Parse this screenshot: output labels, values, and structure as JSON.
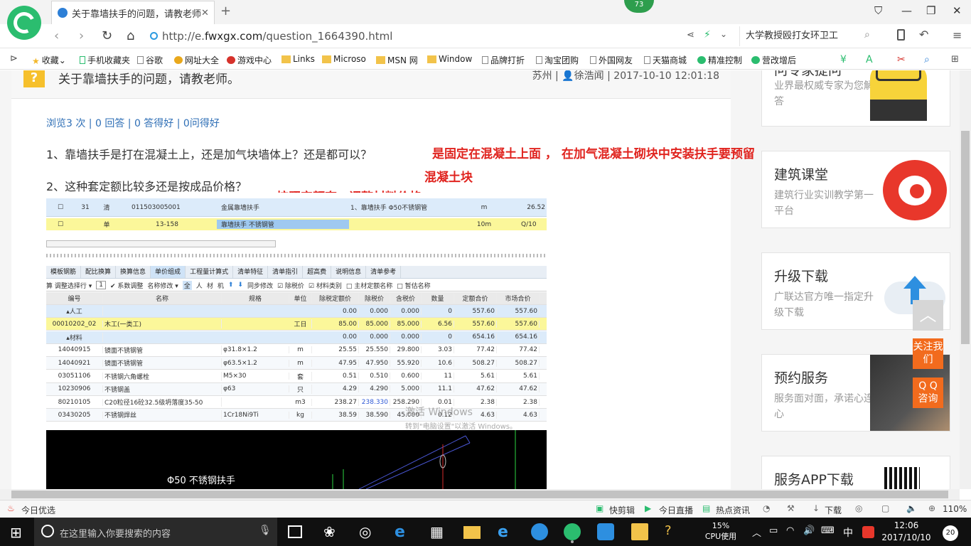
{
  "browser": {
    "tab_title": "关于靠墙扶手的问题，请教老师。",
    "tab_close": "✕",
    "new_tab": "+",
    "badge_count": "73",
    "url_prefix": "http://e.",
    "url_domain": "fwxgx.com",
    "url_path": "/question_1664390.html",
    "search_text": "大学教授殴打女环卫工",
    "bookmarks": [
      "收藏",
      "手机收藏夹",
      "谷歌",
      "网址大全",
      "游戏中心",
      "Links",
      "Microso",
      "MSN 网",
      "Window",
      "品牌打折",
      "淘宝团购",
      "外国网友",
      "天猫商城",
      "精准控制",
      "营改增后"
    ]
  },
  "question": {
    "icon": "?",
    "title": "关于靠墙扶手的问题，请教老师。",
    "city": "苏州",
    "user": "徐浩闻",
    "datetime": "2017-10-10 12:01:18",
    "stats": "浏览3 次 | 0 回答 | 0 答得好 | 0问得好",
    "line1": "1、靠墙扶手是打在混凝土上，还是加气块墙体上？还是都可以？",
    "line2": "2、这种套定额比较多还是按成品价格？",
    "note1": "是固定在混凝土上面 ， 在加气混凝土砌块中安装扶手要预留",
    "note2": "混凝土块",
    "note3": "按照定额套，调整材料价格"
  },
  "screenshot": {
    "top_row": {
      "num": "31",
      "type": "清",
      "code": "011503005001",
      "name": "金属靠墙扶手",
      "desc": "1、靠墙扶手 Φ50不锈钢管",
      "unit": "m",
      "qty": "26.52"
    },
    "sel_row": {
      "type": "单",
      "code": "13-158",
      "name": "靠墙扶手 不锈钢管",
      "unit": "10m",
      "qty": "Q/10"
    },
    "tabs": [
      "模板钢筋",
      "配比换算",
      "换算信息",
      "单价组成",
      "工程量计算式",
      "清单特征",
      "清单指引",
      "超高费",
      "说明信息",
      "清单参考"
    ],
    "toolbar": [
      "算 调整选择行 ▾",
      "1",
      "✔ 系数调整",
      "名称修改 ▾",
      "全",
      "人",
      "材",
      "机",
      "同步修改",
      "☑ 除税价",
      "☑ 材料类别",
      "□ 主材定额名称",
      "□ 暂估名称"
    ],
    "headers": [
      "编号",
      "名称",
      "规格",
      "单位",
      "除税定额价",
      "除税价",
      "含税价",
      "数量",
      "定额合价",
      "市场合价"
    ],
    "rows": [
      [
        "▴人工",
        "",
        "",
        "",
        "0.00",
        "0.000",
        "0.000",
        "0",
        "557.60",
        "557.60"
      ],
      [
        "00010202_02",
        "木工(一类工)",
        "",
        "工日",
        "85.00",
        "85.000",
        "85.000",
        "6.56",
        "557.60",
        "557.60"
      ],
      [
        "▴材料",
        "",
        "",
        "",
        "0.00",
        "0.000",
        "0.000",
        "0",
        "654.16",
        "654.16"
      ],
      [
        "14040915",
        "镜面不锈钢管",
        "φ31.8×1.2",
        "m",
        "25.55",
        "25.550",
        "29.800",
        "3.03",
        "77.42",
        "77.42"
      ],
      [
        "14040921",
        "镜面不锈钢管",
        "φ63.5×1.2",
        "m",
        "47.95",
        "47.950",
        "55.920",
        "10.6",
        "508.27",
        "508.27"
      ],
      [
        "03051106",
        "不锈钢六角螺栓",
        "M5×30",
        "套",
        "0.51",
        "0.510",
        "0.600",
        "11",
        "5.61",
        "5.61"
      ],
      [
        "10230906",
        "不锈钢盖",
        "φ63",
        "只",
        "4.29",
        "4.290",
        "5.000",
        "11.1",
        "47.62",
        "47.62"
      ],
      [
        "80210105",
        "C20粒径16砼32.5级坍落度35-50",
        "",
        "m3",
        "238.27",
        "238.330",
        "258.290",
        "0.01",
        "2.38",
        "2.38"
      ],
      [
        "03430205",
        "不锈钢焊丝",
        "1Cr18Ni9Ti",
        "kg",
        "38.59",
        "38.590",
        "45.000",
        "0.12",
        "4.63",
        "4.63"
      ]
    ],
    "watermark1": "激活 Windows",
    "watermark2": "转到\"电脑设置\"以激活 Windows。",
    "cad_label": "Φ50 不锈钢扶手"
  },
  "sidebar": {
    "cards": [
      {
        "title": "问专家提问",
        "sub": "业界最权威专家为您解答"
      },
      {
        "title": "建筑课堂",
        "sub": "建筑行业实训教学第一平台"
      },
      {
        "title": "升级下载",
        "sub": "广联达官方唯一指定升级下载"
      },
      {
        "title": "预约服务",
        "sub": "服务面对面，承诺心连心"
      },
      {
        "title": "服务APP下载",
        "sub": ""
      }
    ],
    "follow": "关注我们",
    "qq": "Q Q 咨询",
    "top_btn": "︿"
  },
  "statusbar": {
    "left": "今日优选",
    "items": [
      "快剪辑",
      "今日直播",
      "热点资讯",
      "下载"
    ],
    "zoom": "110%"
  },
  "taskbar": {
    "search_placeholder": "在这里输入你要搜索的内容",
    "cpu_pct": "15%",
    "cpu_label": "CPU使用",
    "ime": "中",
    "time": "12:06",
    "date": "2017/10/10",
    "notif": "20"
  },
  "colors": {
    "accent_green": "#2bbd6f",
    "link_blue": "#2f6fb6",
    "note_red": "#e0241f",
    "float_orange": "#f26b1d"
  }
}
